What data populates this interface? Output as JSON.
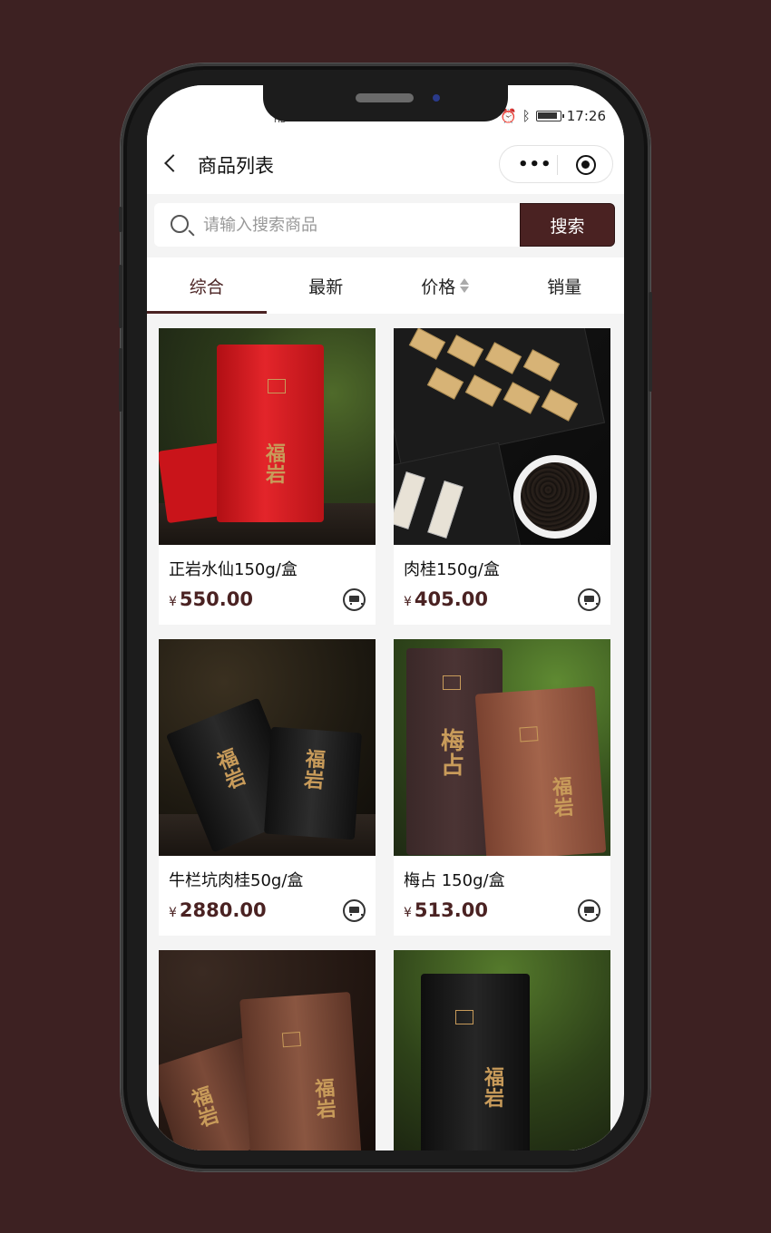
{
  "status_bar": {
    "left_text": "HD",
    "time": "17:26"
  },
  "navbar": {
    "title": "商品列表",
    "back_icon": "chevron-left-icon",
    "menu_icon": "more-dots-icon",
    "close_icon": "target-icon"
  },
  "search": {
    "placeholder": "请输入搜索商品",
    "button_label": "搜索"
  },
  "tabs": [
    {
      "label": "综合",
      "active": true
    },
    {
      "label": "最新",
      "active": false
    },
    {
      "label": "价格",
      "active": false,
      "sortable": true
    },
    {
      "label": "销量",
      "active": false
    }
  ],
  "currency_symbol": "¥",
  "products": [
    {
      "name": "正岩水仙150g/盒",
      "price": "550.00"
    },
    {
      "name": "肉桂150g/盒",
      "price": "405.00"
    },
    {
      "name": "牛栏坑肉桂50g/盒",
      "price": "2880.00"
    },
    {
      "name": "梅占 150g/盒",
      "price": "513.00"
    },
    {
      "name": "",
      "price": ""
    },
    {
      "name": "",
      "price": ""
    }
  ],
  "colors": {
    "brand": "#4a2222",
    "page_background": "#3d2122"
  }
}
